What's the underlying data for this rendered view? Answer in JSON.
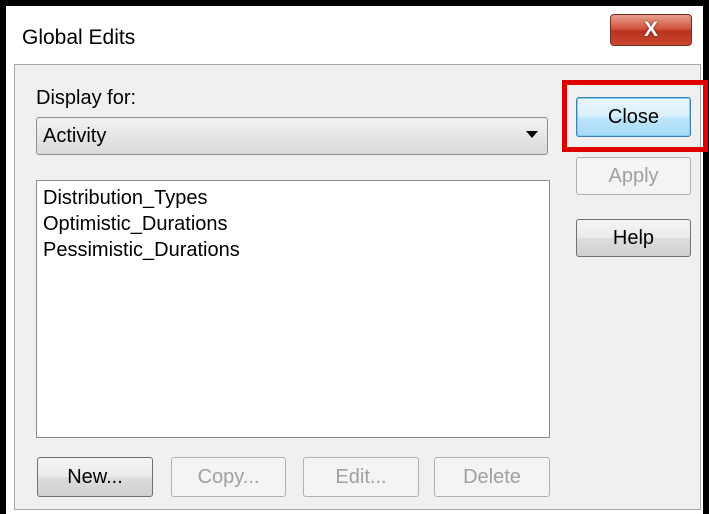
{
  "window": {
    "title": "Global Edits",
    "close_glyph": "X"
  },
  "display_for": {
    "label": "Display for:",
    "selected": "Activity"
  },
  "list": {
    "items": [
      "Distribution_Types",
      "Optimistic_Durations",
      "Pessimistic_Durations"
    ]
  },
  "buttons": {
    "close": "Close",
    "apply": "Apply",
    "help": "Help",
    "new": "New...",
    "copy": "Copy...",
    "edit": "Edit...",
    "delete": "Delete"
  },
  "colors": {
    "highlight": "#e10000",
    "close_x": "#c9482f",
    "focus": "#3c7fb1"
  }
}
